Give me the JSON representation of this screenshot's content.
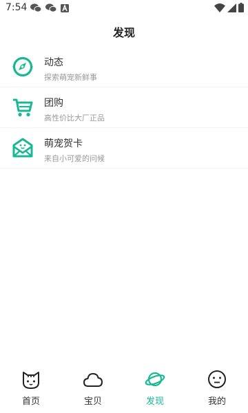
{
  "status_bar": {
    "time": "7:54",
    "left_icons": [
      "wechat-icon",
      "wechat-icon",
      "notification-a-icon"
    ],
    "right_icons": [
      "wifi-icon",
      "signal-icon",
      "battery-icon"
    ]
  },
  "header": {
    "title": "发现"
  },
  "colors": {
    "accent": "#17b893",
    "text": "#333333",
    "subtext": "#9a9a9a"
  },
  "list": [
    {
      "title": "动态",
      "subtitle": "探索萌宠新鲜事",
      "icon": "compass-icon"
    },
    {
      "title": "团购",
      "subtitle": "高性价比大厂正品",
      "icon": "cart-icon"
    },
    {
      "title": "萌宠贺卡",
      "subtitle": "来自小可爱的问候",
      "icon": "envelope-icon"
    }
  ],
  "bottom_nav": [
    {
      "label": "首页",
      "icon": "cat-icon",
      "active": false
    },
    {
      "label": "宝贝",
      "icon": "cloud-icon",
      "active": false
    },
    {
      "label": "发现",
      "icon": "planet-icon",
      "active": true
    },
    {
      "label": "我的",
      "icon": "smiley-icon",
      "active": false
    }
  ]
}
